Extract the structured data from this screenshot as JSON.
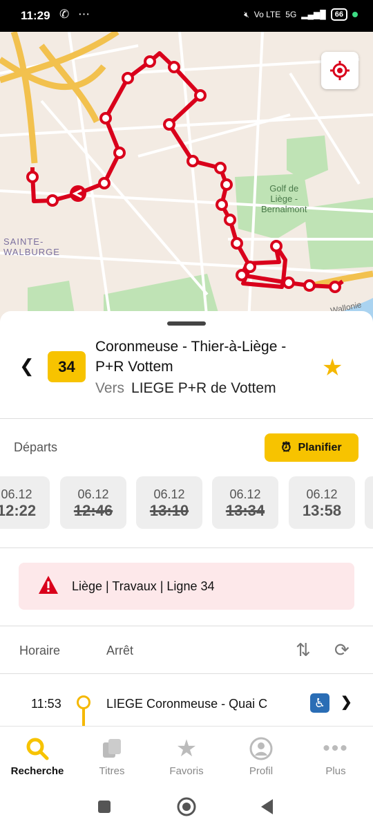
{
  "status_bar": {
    "time": "11:29",
    "left_icons": "whatsapp-icon, more-icon",
    "network": "5G",
    "volte": "Vo LTE",
    "battery": "66"
  },
  "map": {
    "labels": {
      "district": "SAINTE-\nWALBURGE",
      "district_line1": "SAINTE-",
      "district_line2": "WALBURGE",
      "golf_line1": "Golf de",
      "golf_line2": "Liège -",
      "golf_line3": "Bernalmont",
      "road": "Wallonie"
    },
    "route_color": "#d9001b"
  },
  "route": {
    "line_number": "34",
    "title": "Coronmeuse - Thier-à-Liège - P+R Vottem",
    "direction_prefix": "Vers",
    "direction": "LIEGE P+R de Vottem"
  },
  "departures": {
    "label": "Départs",
    "plan_button": "Planifier",
    "items": [
      {
        "date": "06.12",
        "time": "12:22",
        "cancelled": false
      },
      {
        "date": "06.12",
        "time": "12:46",
        "cancelled": true
      },
      {
        "date": "06.12",
        "time": "13:10",
        "cancelled": true
      },
      {
        "date": "06.12",
        "time": "13:34",
        "cancelled": true
      },
      {
        "date": "06.12",
        "time": "13:58",
        "cancelled": false
      }
    ]
  },
  "alert": {
    "text": "Liège | Travaux | Ligne 34"
  },
  "schedule": {
    "col_time": "Horaire",
    "col_stop": "Arrêt",
    "rows": [
      {
        "time": "11:53",
        "stop": "LIEGE Coronmeuse - Quai C"
      }
    ]
  },
  "nav": {
    "items": [
      {
        "label": "Recherche",
        "icon": "search-icon",
        "active": true
      },
      {
        "label": "Titres",
        "icon": "tickets-icon",
        "active": false
      },
      {
        "label": "Favoris",
        "icon": "star-icon",
        "active": false
      },
      {
        "label": "Profil",
        "icon": "profile-icon",
        "active": false
      },
      {
        "label": "Plus",
        "icon": "more-icon",
        "active": false
      }
    ]
  },
  "colors": {
    "accent": "#f7c300",
    "route": "#d9001b",
    "alert_bg": "#fde8ea"
  }
}
